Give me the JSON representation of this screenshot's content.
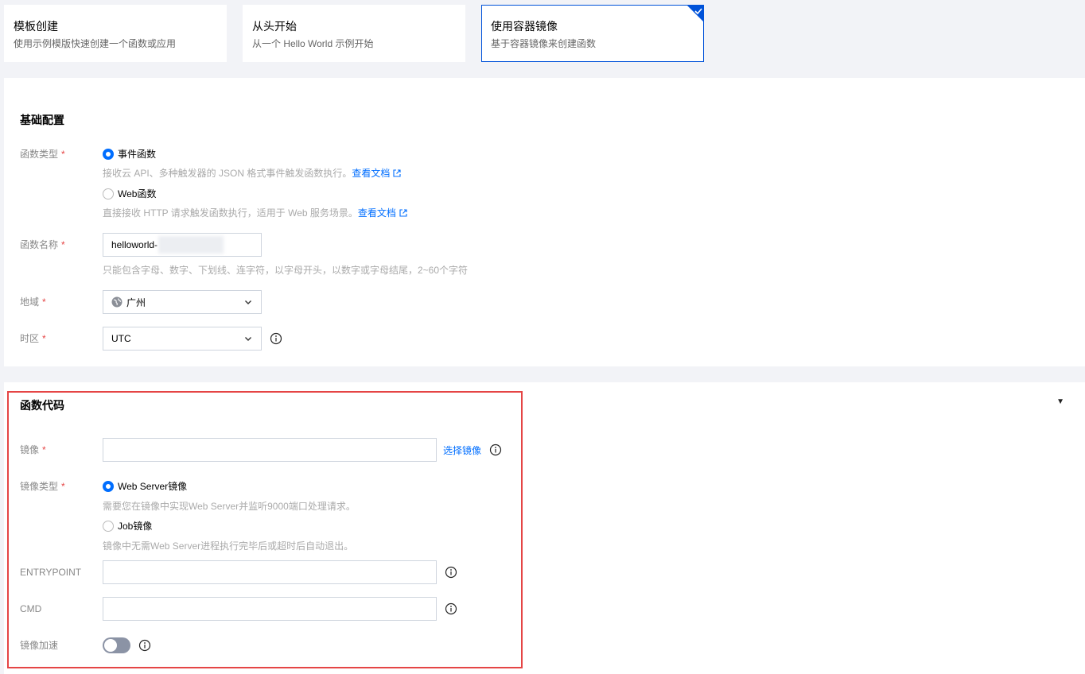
{
  "cards": [
    {
      "title": "模板创建",
      "desc": "使用示例模版快速创建一个函数或应用"
    },
    {
      "title": "从头开始",
      "desc": "从一个 Hello World 示例开始"
    },
    {
      "title": "使用容器镜像",
      "desc": "基于容器镜像来创建函数"
    }
  ],
  "basic": {
    "title": "基础配置",
    "func_type": {
      "label": "函数类型",
      "options": [
        {
          "label": "事件函数",
          "hint": "接收云 API、多种触发器的 JSON 格式事件触发函数执行。",
          "link": "查看文档",
          "selected": true
        },
        {
          "label": "Web函数",
          "hint": "直接接收 HTTP 请求触发函数执行，适用于 Web 服务场景。",
          "link": "查看文档",
          "selected": false
        }
      ]
    },
    "func_name": {
      "label": "函数名称",
      "value": "helloworld-",
      "hint": "只能包含字母、数字、下划线、连字符，以字母开头，以数字或字母结尾，2~60个字符"
    },
    "region": {
      "label": "地域",
      "value": "广州"
    },
    "timezone": {
      "label": "时区",
      "value": "UTC"
    }
  },
  "code": {
    "title": "函数代码",
    "collapse_glyph": "▼",
    "image": {
      "label": "镜像",
      "value": "",
      "select_link": "选择镜像"
    },
    "image_type": {
      "label": "镜像类型",
      "options": [
        {
          "label": "Web Server镜像",
          "hint": "需要您在镜像中实现Web Server并监听9000端口处理请求。",
          "selected": true
        },
        {
          "label": "Job镜像",
          "hint": "镜像中无需Web Server进程执行完毕后或超时后自动退出。",
          "selected": false
        }
      ]
    },
    "entrypoint": {
      "label": "ENTRYPOINT",
      "value": ""
    },
    "cmd": {
      "label": "CMD",
      "value": ""
    },
    "accel": {
      "label": "镜像加速",
      "enabled": false
    }
  },
  "required_mark": "*",
  "colors": {
    "accent": "#006eff",
    "required": "#e54545",
    "highlight_border": "#e54545"
  }
}
